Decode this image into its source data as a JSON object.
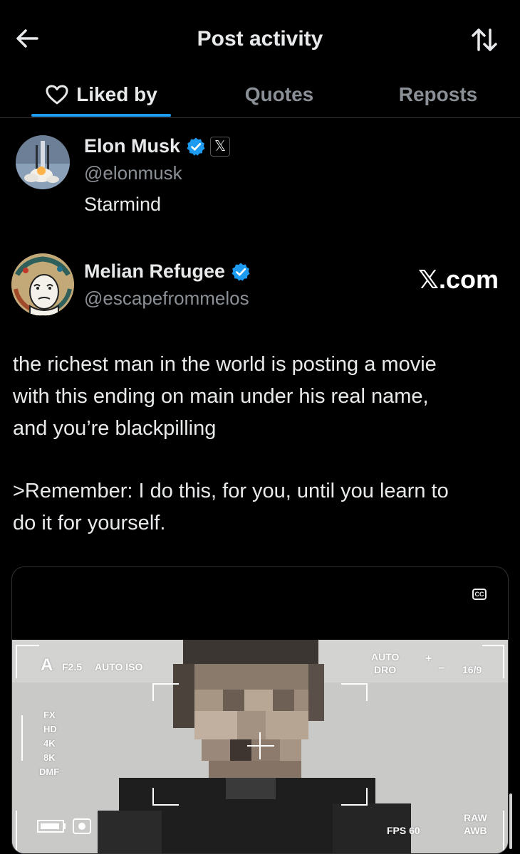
{
  "header": {
    "title": "Post activity",
    "back_icon": "arrow-left-icon",
    "sort_icon": "sort-arrows-icon"
  },
  "tabs": [
    {
      "label": "Liked by",
      "icon": "heart-icon",
      "active": true
    },
    {
      "label": "Quotes",
      "active": false
    },
    {
      "label": "Reposts",
      "active": false
    }
  ],
  "liker": {
    "name": "Elon Musk",
    "handle": "@elonmusk",
    "bio": "Starmind",
    "affiliate_badge": "𝕏"
  },
  "post": {
    "author_name": "Melian Refugee",
    "author_handle": "@escapefrommelos",
    "watermark": "𝕏.com",
    "text_lines": [
      "the richest man in the world is posting a movie",
      "with this ending on main under his real name,",
      "and you’re blackpilling",
      ">Remember: I do this, for you, until you learn to",
      "do it for yourself."
    ]
  },
  "media": {
    "cc_label": "CC",
    "hud": {
      "mode": "A",
      "aperture": "F2.5",
      "iso": "AUTO ISO",
      "dro_top": "AUTO",
      "dro_bottom": "DRO",
      "ev_plus": "+",
      "ev_minus": "−",
      "aspect": "16/9",
      "formats": [
        "FX",
        "HD",
        "4K",
        "8K",
        "DMF"
      ],
      "fps": "FPS 60",
      "raw": "RAW",
      "awb": "AWB"
    }
  },
  "colors": {
    "background": "#000000",
    "text": "#e7e9ea",
    "secondary_text": "#8b9096",
    "accent": "#1d9bf0",
    "divider": "#2f3336"
  }
}
